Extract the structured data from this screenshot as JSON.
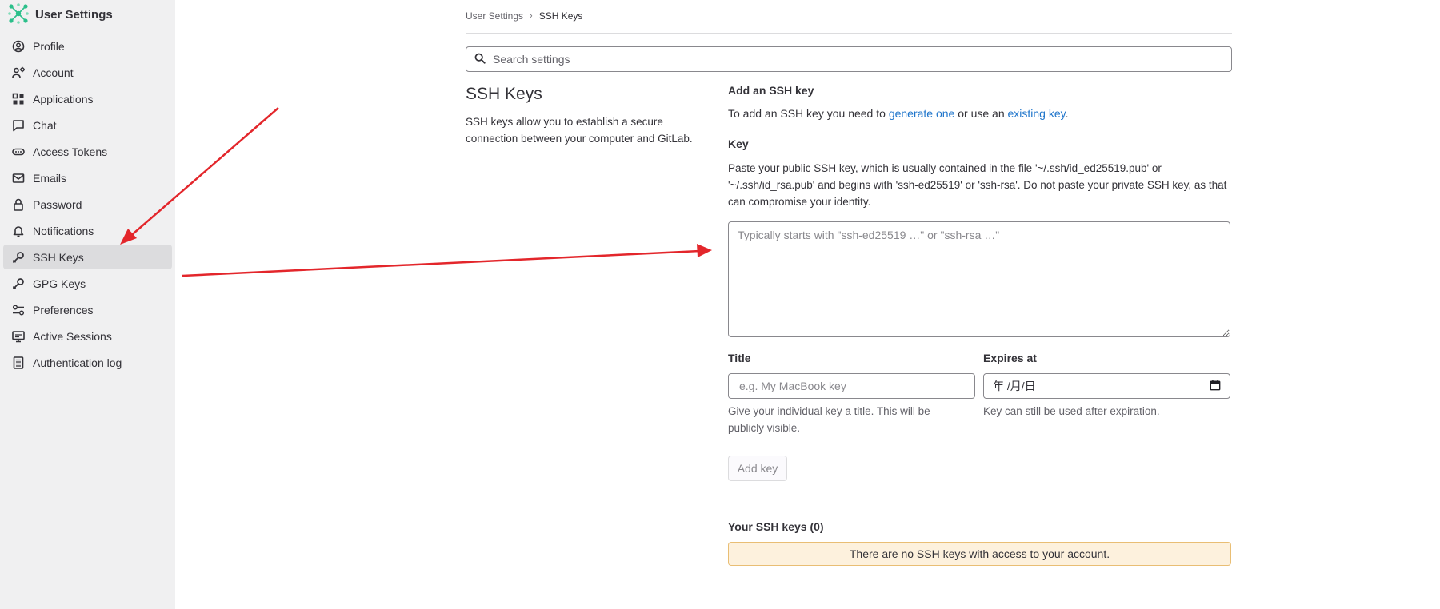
{
  "sidebar": {
    "brand_label": "User Settings",
    "items": [
      {
        "label": "Profile",
        "icon": "profile-icon"
      },
      {
        "label": "Account",
        "icon": "account-icon"
      },
      {
        "label": "Applications",
        "icon": "applications-icon"
      },
      {
        "label": "Chat",
        "icon": "chat-icon"
      },
      {
        "label": "Access Tokens",
        "icon": "token-icon"
      },
      {
        "label": "Emails",
        "icon": "mail-icon"
      },
      {
        "label": "Password",
        "icon": "lock-icon"
      },
      {
        "label": "Notifications",
        "icon": "bell-icon"
      },
      {
        "label": "SSH Keys",
        "icon": "key-icon",
        "active": true
      },
      {
        "label": "GPG Keys",
        "icon": "key-icon"
      },
      {
        "label": "Preferences",
        "icon": "preferences-icon"
      },
      {
        "label": "Active Sessions",
        "icon": "monitor-icon"
      },
      {
        "label": "Authentication log",
        "icon": "log-icon"
      }
    ]
  },
  "breadcrumb": {
    "parent": "User Settings",
    "current": "SSH Keys"
  },
  "search": {
    "placeholder": "Search settings"
  },
  "section": {
    "title": "SSH Keys",
    "description": "SSH keys allow you to establish a secure connection between your computer and GitLab."
  },
  "add_key": {
    "heading": "Add an SSH key",
    "intro_prefix": "To add an SSH key you need to ",
    "generate_link": "generate one",
    "intro_middle": " or use an ",
    "existing_link": "existing key",
    "intro_suffix": ".",
    "key_label": "Key",
    "key_help": "Paste your public SSH key, which is usually contained in the file '~/.ssh/id_ed25519.pub' or '~/.ssh/id_rsa.pub' and begins with 'ssh-ed25519' or 'ssh-rsa'. Do not paste your private SSH key, as that can compromise your identity.",
    "key_placeholder": "Typically starts with \"ssh-ed25519 …\" or \"ssh-rsa …\"",
    "title_label": "Title",
    "title_placeholder": "e.g. My MacBook key",
    "title_help": "Give your individual key a title. This will be publicly visible.",
    "expires_label": "Expires at",
    "expires_value": "年 /月/日",
    "expires_help": "Key can still be used after expiration.",
    "add_button": "Add key"
  },
  "your_keys": {
    "heading": "Your SSH keys (0)",
    "empty_message": "There are no SSH keys with access to your account."
  },
  "colors": {
    "sidebar_bg": "#f0f0f1",
    "active_item_bg": "#dcdcde",
    "link": "#1f75cb",
    "alert_bg": "#fdf1dd",
    "alert_border": "#e9be74",
    "annotation_arrow": "#e3262b"
  }
}
